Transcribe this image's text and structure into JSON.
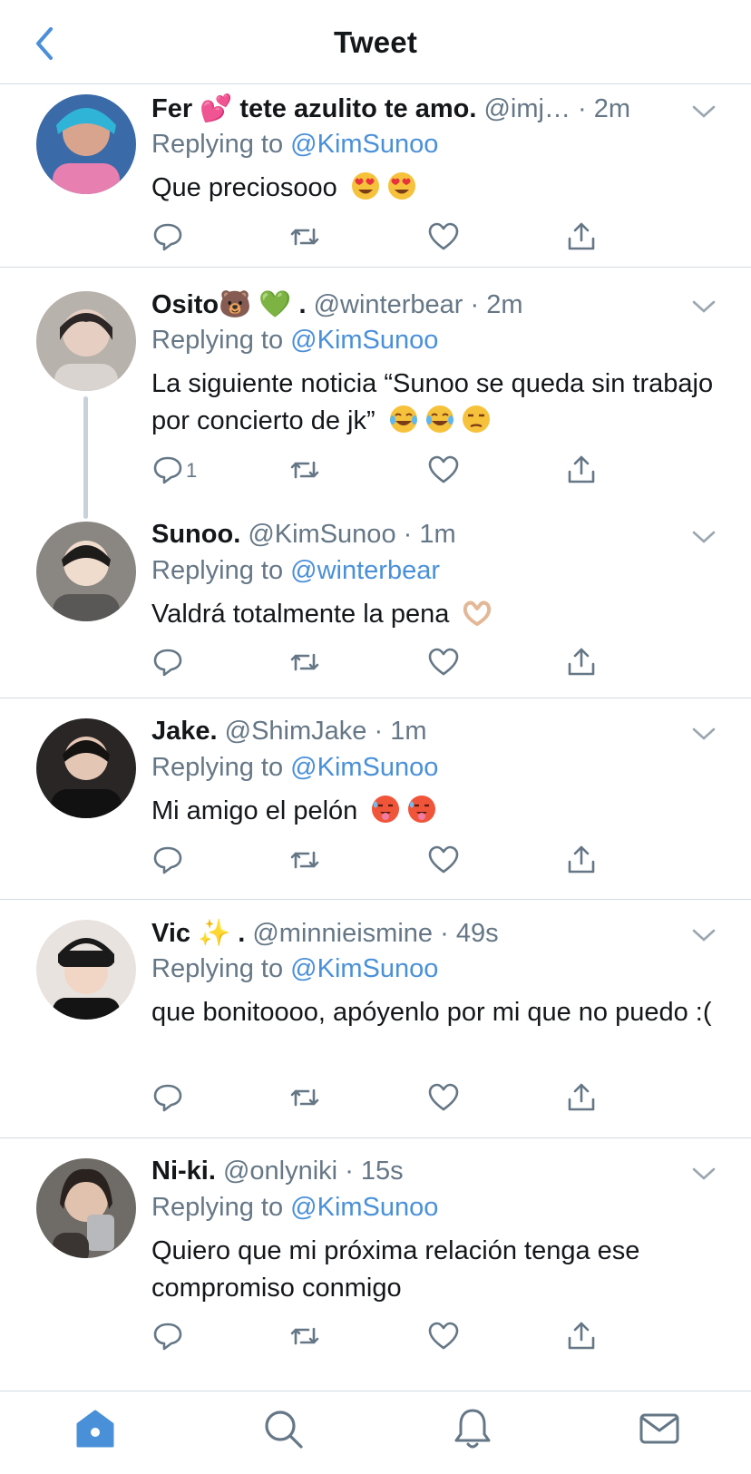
{
  "header": {
    "title": "Tweet"
  },
  "reply_prefix": "Replying to",
  "colors": {
    "link": "#4a90d9",
    "muted": "#657786",
    "divider": "#d5dbe0",
    "accent": "#1da1f2"
  },
  "tweets": [
    {
      "name": "Fer 💕 tete azulito te amo.",
      "handle": "@imj…",
      "time": "2m",
      "reply_to": "@KimSunoo",
      "text": "Que preciosooo",
      "emojis": [
        "heart-eyes-emoji",
        "heart-eyes-emoji"
      ],
      "reply_count": ""
    },
    {
      "name": "Osito🐻 💚 .",
      "handle": "@winterbear",
      "time": "2m",
      "reply_to": "@KimSunoo",
      "text": "La siguiente noticia “Sunoo se queda sin trabajo por concierto de jk”",
      "emojis": [
        "joy-emoji",
        "joy-emoji",
        "unamused-emoji"
      ],
      "reply_count": "1"
    },
    {
      "name": "Sunoo.",
      "handle": "@KimSunoo",
      "time": "1m",
      "reply_to": "@winterbear",
      "text": "Valdrá totalmente la pena",
      "emojis": [
        "heart-hands-emoji"
      ],
      "reply_count": ""
    },
    {
      "name": "Jake.",
      "handle": "@ShimJake",
      "time": "1m",
      "reply_to": "@KimSunoo",
      "text": "Mi amigo el pelón",
      "emojis": [
        "hot-face-emoji",
        "hot-face-emoji"
      ],
      "reply_count": ""
    },
    {
      "name": "Vic ✨ .",
      "handle": "@minnieismine",
      "time": "49s",
      "reply_to": "@KimSunoo",
      "text": "que bonitoooo, apóyenlo por mi que no puedo :(",
      "emojis": [],
      "reply_count": ""
    },
    {
      "name": "Ni-ki.",
      "handle": "@onlyniki",
      "time": "15s",
      "reply_to": "@KimSunoo",
      "text": "Quiero que mi próxima relación tenga ese compromiso conmigo",
      "emojis": [],
      "reply_count": ""
    }
  ],
  "tabbar": [
    "home-icon",
    "search-icon",
    "notifications-icon",
    "messages-icon"
  ]
}
